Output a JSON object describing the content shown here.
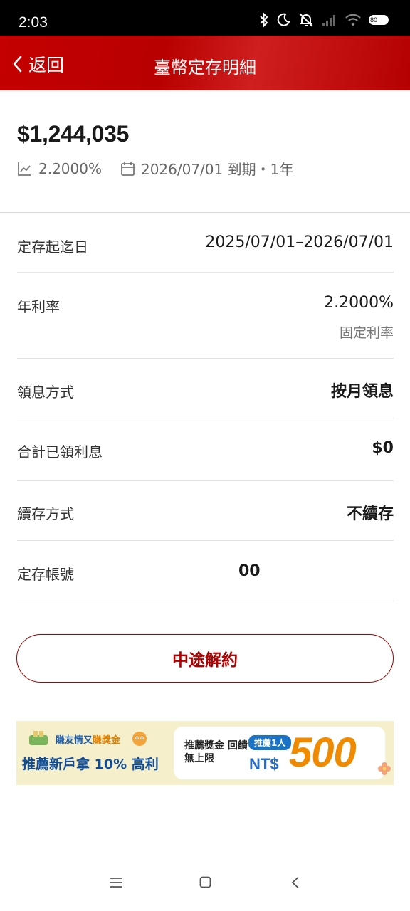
{
  "status_bar": {
    "time": "2:03",
    "battery": "80",
    "icons": [
      "bluetooth-icon",
      "moon-icon",
      "bell-off-icon",
      "signal-icon",
      "wifi-icon",
      "battery-icon"
    ]
  },
  "header": {
    "back_label": "返回",
    "title": "臺幣定存明細"
  },
  "summary": {
    "amount": "$1,244,035",
    "rate": "2.2000%",
    "maturity": "2026/07/01 到期・1年"
  },
  "details": [
    {
      "label": "定存起迄日",
      "value": "2025/07/01–2026/07/01"
    },
    {
      "label": "年利率",
      "value": "2.2000%",
      "sub": "固定利率"
    },
    {
      "label": "領息方式",
      "value": "按月領息"
    },
    {
      "label": "合計已領利息",
      "value": "$0"
    },
    {
      "label": "續存方式",
      "value": "不續存"
    },
    {
      "label": "定存帳號",
      "value": "00"
    }
  ],
  "actions": {
    "terminate_label": "中途解約"
  },
  "banner": {
    "tag_prefix": "賺友情又",
    "tag_highlight": "賺獎金",
    "headline": "推薦新戶拿",
    "rate_text": "10% 高利",
    "bonus_text": "推薦獎金 回饋無上限",
    "pill": "推薦1人",
    "currency": "NT$",
    "amount": "500"
  },
  "colors": {
    "brand_red": "#c40000",
    "button_red": "#b00000",
    "banner_bg": "#f5efcc",
    "banner_blue": "#114c98",
    "banner_orange": "#f08a00"
  }
}
